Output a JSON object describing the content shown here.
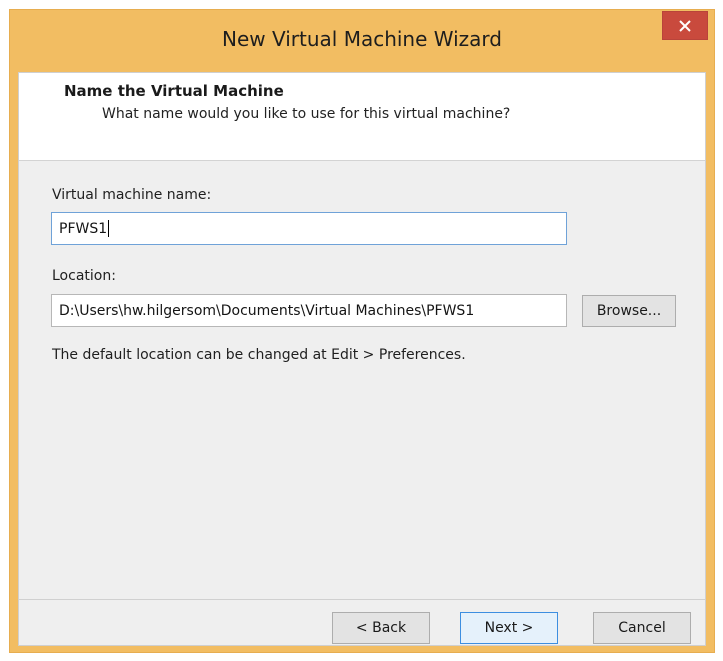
{
  "window": {
    "title": "New Virtual Machine Wizard"
  },
  "header": {
    "title": "Name the Virtual Machine",
    "subtitle": "What name would you like to use for this virtual machine?"
  },
  "form": {
    "name_label": "Virtual machine name:",
    "name_value": "PFWS1",
    "location_label": "Location:",
    "location_value": "D:\\Users\\hw.hilgersom\\Documents\\Virtual Machines\\PFWS1",
    "browse_label": "Browse...",
    "hint": "The default location can be changed at Edit > Preferences."
  },
  "footer": {
    "back_label": "< Back",
    "next_label": "Next >",
    "cancel_label": "Cancel"
  },
  "icons": {
    "close": "close-icon"
  },
  "colors": {
    "titlebar": "#f2bd62",
    "close_button": "#c94a3d",
    "default_button_border": "#3d8ee0"
  }
}
